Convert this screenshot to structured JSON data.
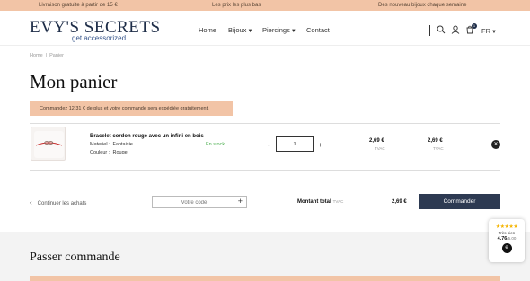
{
  "topbar": {
    "msg1": "Livraison gratuite à partir de 15 €",
    "msg2": "Les prix les plus bas",
    "msg3": "Des nouveau bijoux chaque semaine"
  },
  "header": {
    "logo_main": "EVY'S SECRETS",
    "logo_sub": "get accessorized",
    "nav": [
      "Home",
      "Bijoux",
      "Piercings",
      "Contact"
    ],
    "cart_count": "1",
    "language": "FR"
  },
  "breadcrumb": {
    "home": "Home",
    "sep": "|",
    "current": "Panier"
  },
  "page_title": "Mon panier",
  "notice": "Commandez 12,31 € de plus et votre commande sera expédiée gratuitement.",
  "cart_item": {
    "name": "Bracelet cordon rouge avec un infini en bois",
    "material_label": "Materiel :",
    "material_value": "Fantaisie",
    "color_label": "Couleur :",
    "color_value": "Rouge",
    "stock": "En stock",
    "qty_minus": "-",
    "quantity": "1",
    "qty_plus": "+",
    "unit_price": "2,69 €",
    "unit_price_tax": "TVAC",
    "line_total": "2,69 €",
    "line_total_tax": "TVAC",
    "remove": "✕"
  },
  "footer_row": {
    "continue_label": "Continuer les achats",
    "promo_placeholder": "Votre code",
    "promo_add": "+",
    "total_label": "Montant total",
    "total_tax": "TVAC",
    "total_value": "2,69 €",
    "order_button": "Commander"
  },
  "checkout": {
    "title": "Passer commande"
  },
  "reviews": {
    "stars": "★★★★★",
    "label": "Très bien",
    "score": "4.76",
    "max": "/5.00"
  },
  "colors": {
    "accent_peach": "#f2c4a6",
    "brand_navy": "#2d3a52",
    "stock_green": "#4caf50"
  }
}
